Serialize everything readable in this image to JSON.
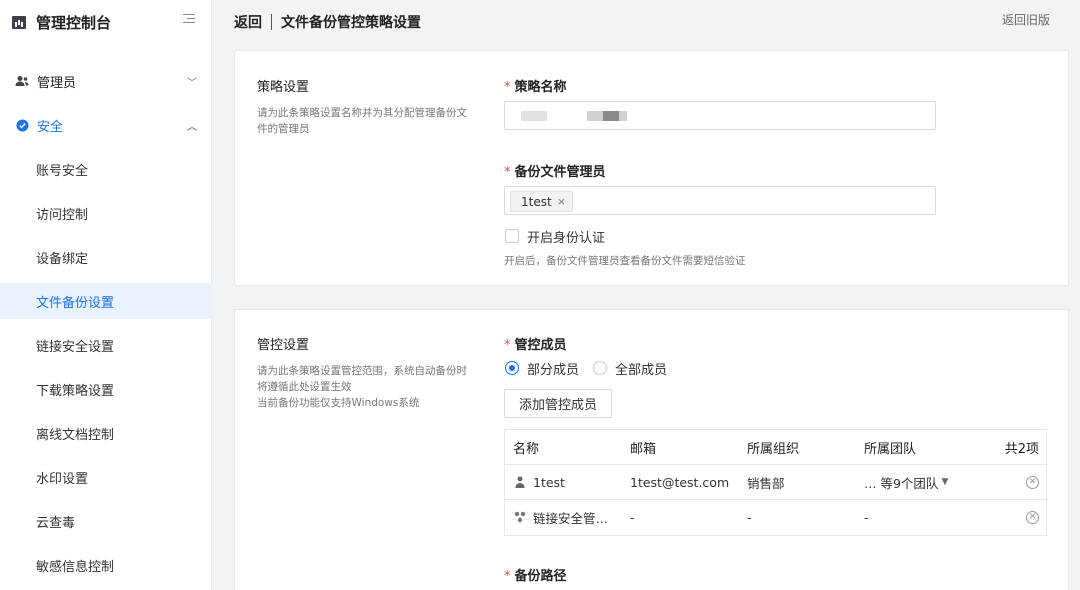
{
  "sidebar": {
    "title": "管理控制台",
    "groups": [
      {
        "label": "管理员",
        "expanded": false
      },
      {
        "label": "安全",
        "expanded": true
      }
    ],
    "items": [
      "账号安全",
      "访问控制",
      "设备绑定",
      "文件备份设置",
      "链接安全设置",
      "下载策略设置",
      "离线文档控制",
      "水印设置",
      "云查毒",
      "敏感信息控制"
    ],
    "selected_item": "文件备份设置"
  },
  "header": {
    "back": "返回",
    "title": "文件备份管控策略设置",
    "old_version": "返回旧版"
  },
  "policy_section": {
    "title": "策略设置",
    "desc": "请为此条策略设置名称并为其分配管理备份文件的管理员",
    "name_label": "策略名称",
    "admin_label": "备份文件管理员",
    "admin_tags": [
      "1test"
    ],
    "auth_checkbox": "开启身份认证",
    "auth_checked": false,
    "auth_hint": "开启后，备份文件管理员查看备份文件需要短信验证"
  },
  "control_section": {
    "title": "管控设置",
    "desc": "请为此条策略设置管控范围，系统自动备份时将遵循此处设置生效\n当前备份功能仅支持Windows系统",
    "members_label": "管控成员",
    "radio_partial": "部分成员",
    "radio_all": "全部成员",
    "selected": "部分成员",
    "add_button": "添加管控成员",
    "table": {
      "headers": [
        "名称",
        "邮箱",
        "所属组织",
        "所属团队"
      ],
      "total": "共2项",
      "rows": [
        {
          "type": "user",
          "name": "1test",
          "email": "1test@test.com",
          "org": "销售部",
          "team": "… 等9个团队"
        },
        {
          "type": "group",
          "name": "链接安全管…",
          "email": "-",
          "org": "-",
          "team": "-"
        }
      ]
    },
    "path_label": "备份路径"
  },
  "colors": {
    "accent": "#1a73e8",
    "required": "#e5484d"
  }
}
